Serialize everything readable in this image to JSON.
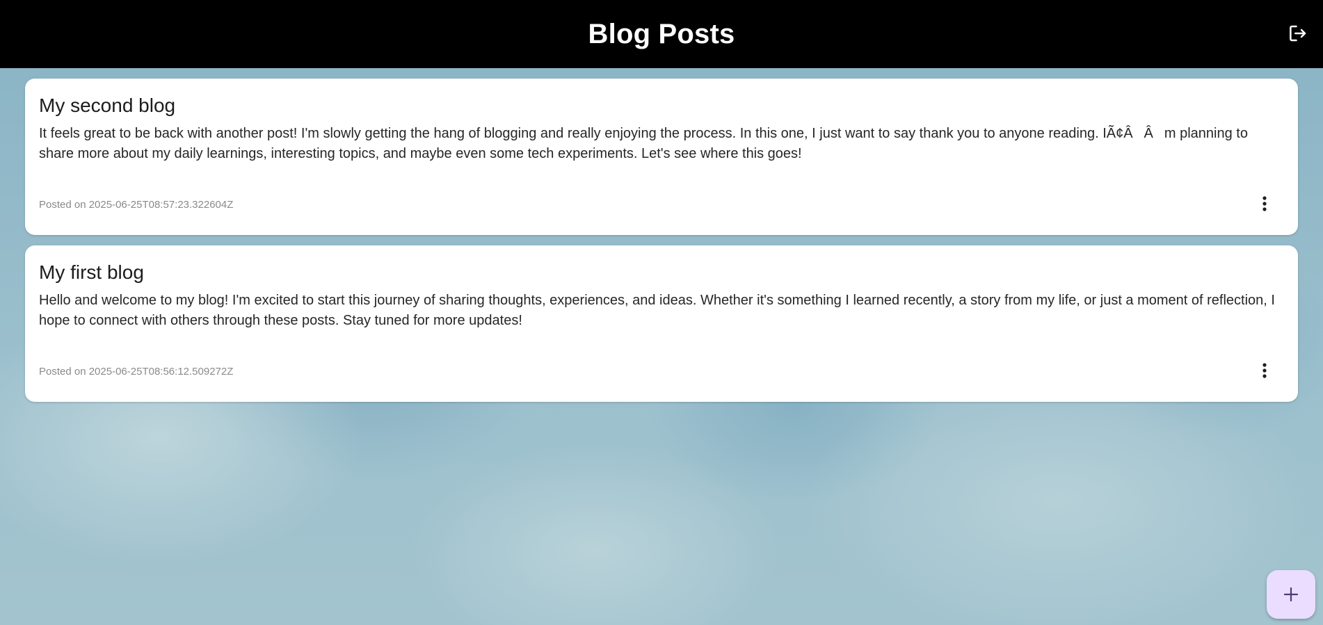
{
  "header": {
    "title": "Blog Posts",
    "logout_icon": "logout-icon"
  },
  "posts": [
    {
      "title": "My second blog",
      "body": "It feels great to be back with another post! I'm slowly getting the hang of blogging and really enjoying the process. In this one, I just want to say thank you to anyone reading. IÃ¢ÂÂm planning to share more about my daily learnings, interesting topics, and maybe even some tech experiments. Let's see where this goes!",
      "date": "Posted on 2025-06-25T08:57:23.322604Z",
      "menu_icon": "more-vert-icon"
    },
    {
      "title": "My first blog",
      "body": "Hello and welcome to my blog! I'm excited to start this journey of sharing thoughts, experiences, and ideas. Whether it's something I learned recently, a story from my life, or just a moment of reflection, I hope to connect with others through these posts. Stay tuned for more updates!",
      "date": "Posted on 2025-06-25T08:56:12.509272Z",
      "menu_icon": "more-vert-icon"
    }
  ],
  "fab": {
    "icon": "add-icon"
  },
  "colors": {
    "appbar": "#000000",
    "fab": "#ebddff",
    "fab_icon": "#4a3a75"
  }
}
